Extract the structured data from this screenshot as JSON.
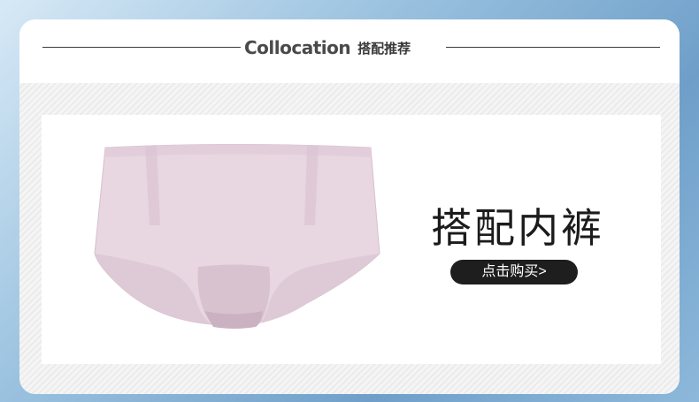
{
  "section": {
    "title_en": "Collocation",
    "title_cn": "搭配推荐"
  },
  "product": {
    "name": "搭配内裤",
    "buy_label": "点击购买>",
    "image_icon": "pink-briefs-image"
  },
  "colors": {
    "fabric": "#e8d6e1",
    "fabric_shadow": "#d9c2d0",
    "button": "#1e1e1e",
    "title_text": "#4a4a4a"
  }
}
